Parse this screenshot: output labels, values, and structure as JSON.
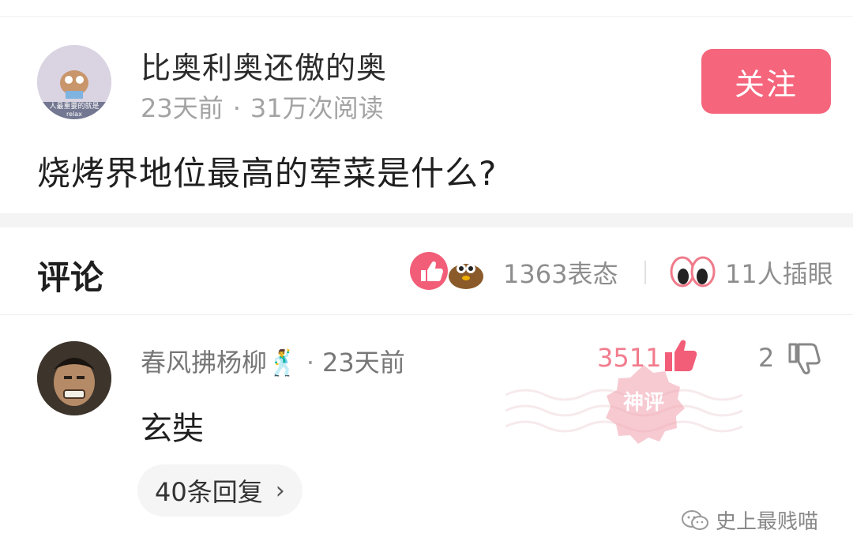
{
  "post": {
    "author": "比奥利奥还傲的奥",
    "time": "23天前",
    "views": "31万次阅读",
    "follow_label": "关注",
    "avatar_caption": "人最重要的就是",
    "avatar_caption2": "relax",
    "question": "烧烤界地位最高的荤菜是什么?"
  },
  "comments_header": {
    "title": "评论",
    "reactions": "1363表态",
    "peek": "11人插眼"
  },
  "comment": {
    "user": "春风拂杨柳🕺",
    "time": "23天前",
    "likes": "3511",
    "dislikes": "2",
    "text": "玄奘",
    "stamp_text": "神评",
    "replies_label": "40条回复",
    "replies_chevron": "›"
  },
  "watermark": {
    "label": "史上最贱喵"
  },
  "colors": {
    "accent": "#f5657c",
    "like": "#f27b8d"
  }
}
